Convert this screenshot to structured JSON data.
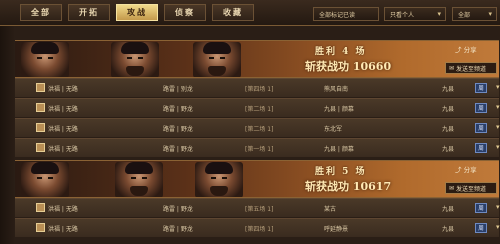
{
  "tabs": [
    {
      "label": "全部",
      "active": false
    },
    {
      "label": "开拓",
      "active": false
    },
    {
      "label": "攻战",
      "active": true
    },
    {
      "label": "侦察",
      "active": false
    },
    {
      "label": "收藏",
      "active": false
    }
  ],
  "filters": {
    "mark_filter": "全部标记已读",
    "scope": "只看个人",
    "type": "全部"
  },
  "reports": [
    {
      "result": "胜利 4 场",
      "score_label": "斩获战功",
      "score": "10660",
      "share_label": "分享",
      "send_label": "发送至频道",
      "rows": [
        {
          "player": "洪福 | 无路",
          "opponent": "路雷 | 别龙",
          "round": "[第四场 1]",
          "target": "熊风自南",
          "server": "九县",
          "badge": "周"
        },
        {
          "player": "洪福 | 无路",
          "opponent": "路雷 | 野龙",
          "round": "[第二场 1]",
          "target": "九县 | 颜慕",
          "server": "九县",
          "badge": "周"
        },
        {
          "player": "洪福 | 无路",
          "opponent": "路雷 | 野龙",
          "round": "[第二场 1]",
          "target": "东北军",
          "server": "九县",
          "badge": "周"
        },
        {
          "player": "洪福 | 无路",
          "opponent": "路雷 | 野龙",
          "round": "[第一场 1]",
          "target": "九县 | 颜慕",
          "server": "九县",
          "badge": "周"
        }
      ]
    },
    {
      "result": "胜利 5 场",
      "score_label": "斩获战功",
      "score": "10617",
      "share_label": "分享",
      "send_label": "发送至频道",
      "rows": [
        {
          "player": "洪福 | 无路",
          "opponent": "路雷 | 野龙",
          "round": "[第五场 1]",
          "target": "某古",
          "server": "九县",
          "badge": "周"
        },
        {
          "player": "洪福 | 无路",
          "opponent": "路雷 | 野龙",
          "round": "[第四场 1]",
          "target": "呼延静熹",
          "server": "九县",
          "badge": "周"
        }
      ]
    }
  ]
}
